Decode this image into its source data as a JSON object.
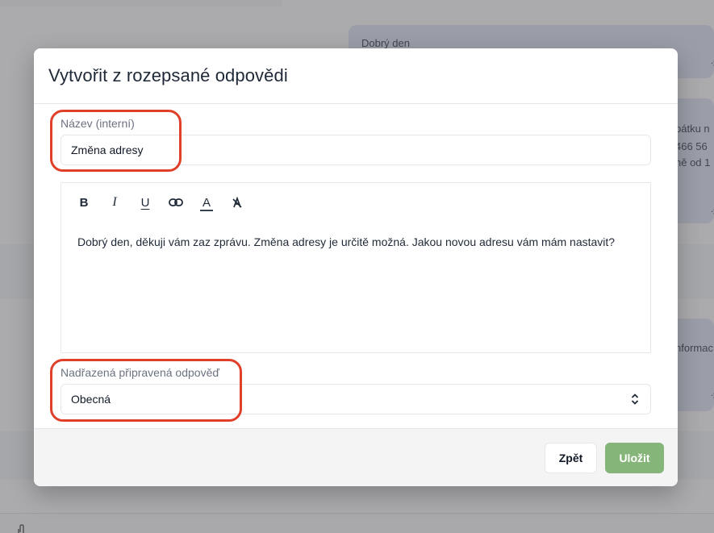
{
  "background": {
    "message_1": "Dobrý den",
    "message_2_lines": [
      "pátku n",
      " 466 56",
      "ně od 1"
    ],
    "message_3": "nformac"
  },
  "modal": {
    "title": "Vytvořit z rozepsané odpovědi",
    "name_field": {
      "label": "Název (interní)",
      "value": "Změna adresy"
    },
    "editor": {
      "toolbar": {
        "bold": "B",
        "italic": "I",
        "underline": "U",
        "link_icon": "link-icon",
        "text_color": "A",
        "clear_format": "clear-format-icon"
      },
      "content": "Dobrý den, děkuji vám zaz zprávu. Změna adresy je určitě možná. Jakou novou adresu  vám mám nastavit?"
    },
    "parent_field": {
      "label": "Nadřazená připravená odpověď",
      "selected": "Obecná"
    },
    "footer": {
      "back_label": "Zpět",
      "save_label": "Uložit"
    }
  },
  "colors": {
    "save_button": "#86b57a",
    "highlight": "#e0402a",
    "message_bubble": "#d6ddec"
  }
}
